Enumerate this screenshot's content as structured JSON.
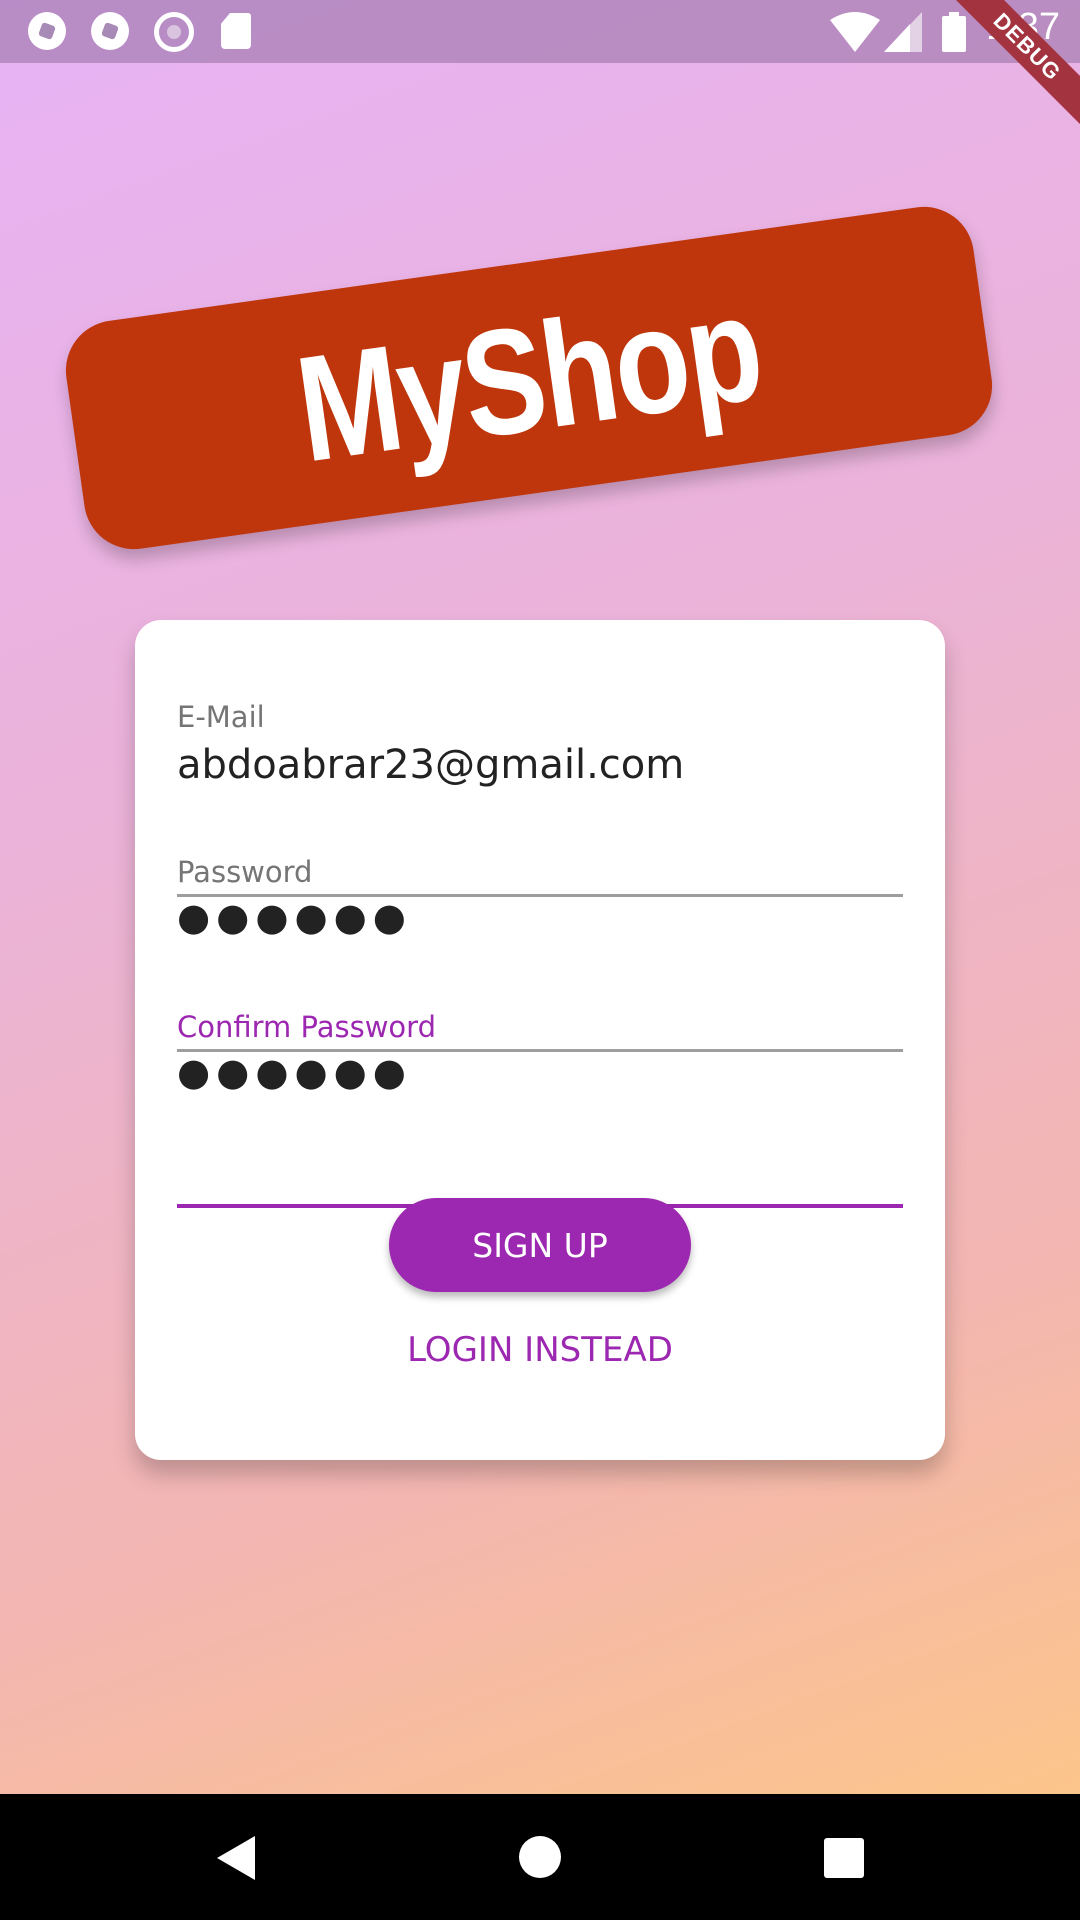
{
  "status_bar": {
    "time": "1:37",
    "debug_label": "DEBUG",
    "icons": [
      "soccer-ball-icon",
      "soccer-ball-icon",
      "radio-circle-icon",
      "sd-card-icon",
      "wifi-icon",
      "signal-icon",
      "battery-icon"
    ]
  },
  "logo": {
    "text": "MyShop",
    "color": "#bf360c"
  },
  "form": {
    "email": {
      "label": "E-Mail",
      "value": "abdoabrar23@gmail.com"
    },
    "password": {
      "label": "Password",
      "value": "●●●●●●"
    },
    "confirm_password": {
      "label": "Confirm Password",
      "value": "●●●●●●"
    }
  },
  "actions": {
    "signup_label": "SIGN UP",
    "login_label": "LOGIN INSTEAD"
  },
  "colors": {
    "accent": "#9c27b0",
    "logo_bg": "#bf360c"
  }
}
